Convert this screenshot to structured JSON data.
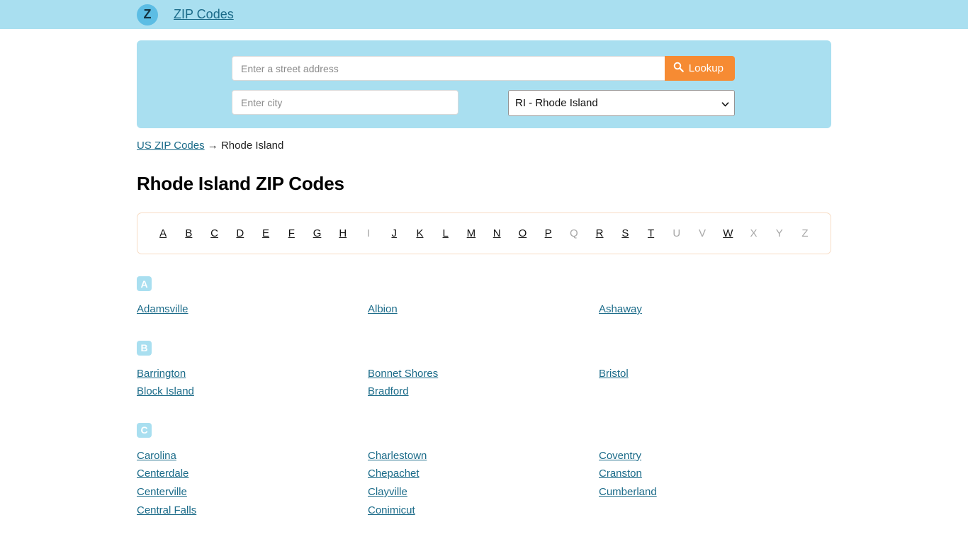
{
  "header": {
    "logo_letter": "Z",
    "brand_label": "ZIP Codes"
  },
  "search": {
    "address_placeholder": "Enter a street address",
    "address_value": "",
    "city_placeholder": "Enter city",
    "city_value": "",
    "lookup_label": "Lookup",
    "lookup_icon": "search-icon",
    "state_selected": "RI - Rhode Island",
    "state_caret_icon": "chevron-down-icon",
    "panel_color": "#a9dff0",
    "button_color": "#f68b33"
  },
  "breadcrumb": {
    "home_label": "US ZIP Codes",
    "separator": "→",
    "current_label": "Rhode Island"
  },
  "page_title": "Rhode Island ZIP Codes",
  "alphabet": [
    {
      "letter": "A",
      "enabled": true
    },
    {
      "letter": "B",
      "enabled": true
    },
    {
      "letter": "C",
      "enabled": true
    },
    {
      "letter": "D",
      "enabled": true
    },
    {
      "letter": "E",
      "enabled": true
    },
    {
      "letter": "F",
      "enabled": true
    },
    {
      "letter": "G",
      "enabled": true
    },
    {
      "letter": "H",
      "enabled": true
    },
    {
      "letter": "I",
      "enabled": false
    },
    {
      "letter": "J",
      "enabled": true
    },
    {
      "letter": "K",
      "enabled": true
    },
    {
      "letter": "L",
      "enabled": true
    },
    {
      "letter": "M",
      "enabled": true
    },
    {
      "letter": "N",
      "enabled": true
    },
    {
      "letter": "O",
      "enabled": true
    },
    {
      "letter": "P",
      "enabled": true
    },
    {
      "letter": "Q",
      "enabled": false
    },
    {
      "letter": "R",
      "enabled": true
    },
    {
      "letter": "S",
      "enabled": true
    },
    {
      "letter": "T",
      "enabled": true
    },
    {
      "letter": "U",
      "enabled": false
    },
    {
      "letter": "V",
      "enabled": false
    },
    {
      "letter": "W",
      "enabled": true
    },
    {
      "letter": "X",
      "enabled": false
    },
    {
      "letter": "Y",
      "enabled": false
    },
    {
      "letter": "Z",
      "enabled": false
    }
  ],
  "sections": [
    {
      "letter": "A",
      "columns": [
        [
          "Adamsville"
        ],
        [
          "Albion"
        ],
        [
          "Ashaway"
        ]
      ]
    },
    {
      "letter": "B",
      "columns": [
        [
          "Barrington",
          "Block Island"
        ],
        [
          "Bonnet Shores",
          "Bradford"
        ],
        [
          "Bristol"
        ]
      ]
    },
    {
      "letter": "C",
      "columns": [
        [
          "Carolina",
          "Centerdale",
          "Centerville",
          "Central Falls"
        ],
        [
          "Charlestown",
          "Chepachet",
          "Clayville",
          "Conimicut"
        ],
        [
          "Coventry",
          "Cranston",
          "Cumberland"
        ]
      ]
    }
  ]
}
